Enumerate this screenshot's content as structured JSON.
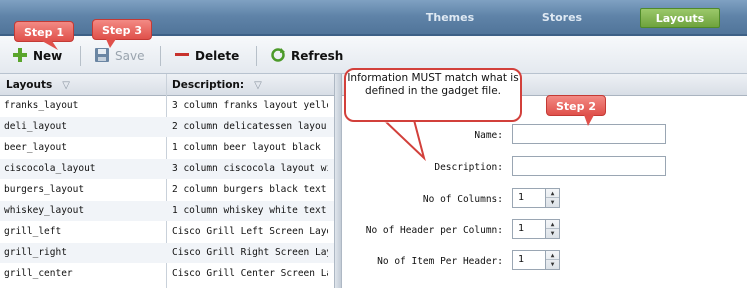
{
  "nav": {
    "tabs": [
      {
        "label": "Themes",
        "active": false
      },
      {
        "label": "Stores",
        "active": false
      },
      {
        "label": "Layouts",
        "active": true
      }
    ]
  },
  "toolbar": {
    "new_label": "New",
    "save_label": "Save",
    "delete_label": "Delete",
    "refresh_label": "Refresh"
  },
  "steps": {
    "step1": "Step 1",
    "step2": "Step 2",
    "step3": "Step 3"
  },
  "info_callout": "Information MUST match what is defined in the gadget file.",
  "grid": {
    "columns": [
      "Layouts",
      "Description:"
    ],
    "rows": [
      [
        "franks_layout",
        "3 column franks layout yello"
      ],
      [
        "deli_layout",
        "2 column delicatessen layou"
      ],
      [
        "beer_layout",
        "1 column beer layout black"
      ],
      [
        "ciscocola_layout",
        "3 column ciscocola layout wi"
      ],
      [
        "burgers_layout",
        "2 column burgers black text"
      ],
      [
        "whiskey_layout",
        "1 column whiskey white text"
      ],
      [
        "grill_left",
        "Cisco Grill Left Screen Layou"
      ],
      [
        "grill_right",
        "Cisco Grill Right Screen Layo"
      ],
      [
        "grill_center",
        "Cisco Grill Center Screen Lay"
      ]
    ]
  },
  "form": {
    "name_label": "Name:",
    "name_value": "",
    "description_label": "Description:",
    "description_value": "",
    "columns_label": "No of Columns:",
    "columns_value": "1",
    "header_label": "No of Header per Column:",
    "header_value": "1",
    "item_label": "No of Item Per Header:",
    "item_value": "1"
  },
  "icons": {
    "new": "plus-icon",
    "save": "floppy-disk-icon",
    "delete": "minus-icon",
    "refresh": "refresh-icon",
    "filter": "filter-icon"
  },
  "colors": {
    "accent": "#6ea33d",
    "step": "#e0504a",
    "nav": "#5f83a8"
  }
}
